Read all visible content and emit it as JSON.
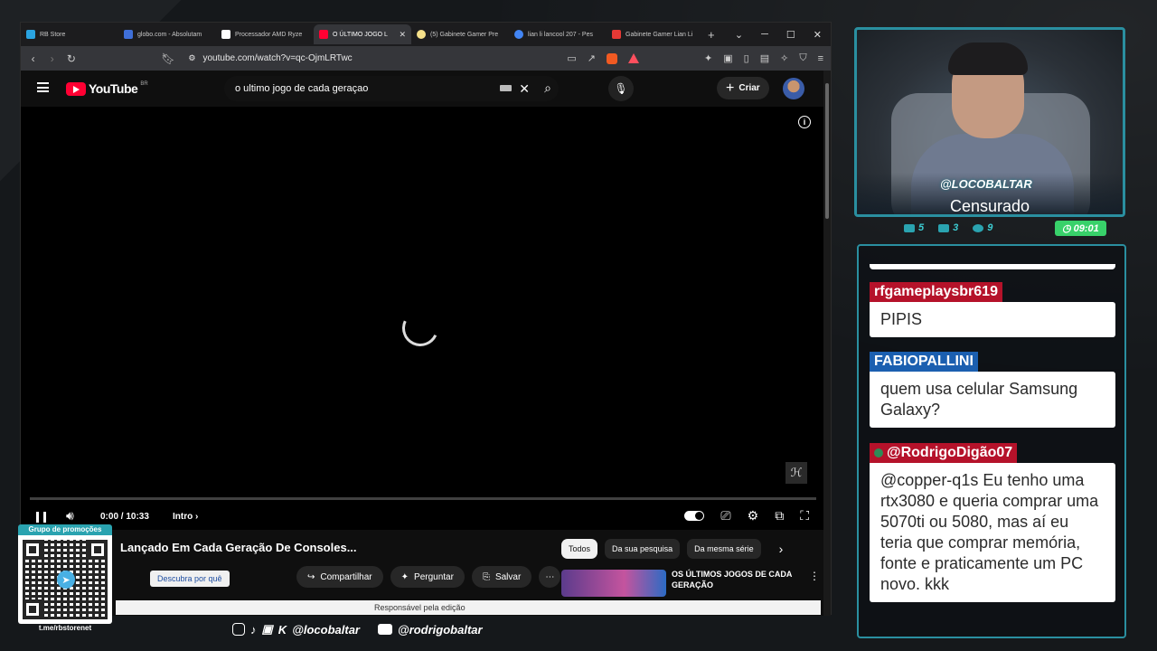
{
  "browser": {
    "tabs": [
      {
        "label": "RB Store",
        "color": "#2aa3e0"
      },
      {
        "label": "globo.com - Absolutam",
        "color": "#3f6fd8"
      },
      {
        "label": "Processador AMD Ryze",
        "color": "#ffffff"
      },
      {
        "label": "O ÚLTIMO JOGO L",
        "color": "#ff0033",
        "active": true
      },
      {
        "label": "(5) Gabinete Gamer Pre",
        "color": "#f5e08a"
      },
      {
        "label": "lian li lancool 207 - Pes",
        "color": "#4285f4"
      },
      {
        "label": "Gabinete Gamer Lian Li",
        "color": "#e53935"
      }
    ],
    "url": "youtube.com/watch?v=qc-OjmLRTwc"
  },
  "youtube": {
    "logo_text": "YouTube",
    "country": "BR",
    "search_value": "o ultimo jogo de cada geraçao",
    "create_label": "Criar",
    "player": {
      "time": "0:00 / 10:33",
      "chapter": "Intro",
      "progress": 0
    },
    "video_title": "Lançado Em Cada Geração De Consoles...",
    "actions": [
      "Compartilhar",
      "Perguntar",
      "Salvar"
    ],
    "chips": [
      "Todos",
      "Da sua pesquisa",
      "Da mesma série"
    ],
    "rec_title": "OS ÚLTIMOS JOGOS DE CADA GERAÇÃO",
    "tooltip": "Descubra por quê",
    "status": "Responsável pela edição"
  },
  "stream": {
    "handle": "@LOCOBALTAR",
    "status": "Censurado",
    "stats": [
      "5",
      "3",
      "9"
    ],
    "timer": "09:01",
    "accent": "#2a8fa0"
  },
  "chat": {
    "messages": [
      {
        "user": "rfgameplaysbr619",
        "text": "PIPIS",
        "color": "red"
      },
      {
        "user": "FABIOPALLINI",
        "text": "quem usa celular Samsung Galaxy?",
        "color": "blue"
      },
      {
        "user": "@RodrigoDigão07",
        "text": "@copper-q1s Eu tenho uma rtx3080 e queria comprar uma 5070ti ou 5080, mas aí eu teria que comprar memória, fonte e praticamente um PC novo. kkk",
        "color": "red"
      }
    ]
  },
  "promo": {
    "label": "Grupo de promoções",
    "url": "t.me/rbstorenet"
  },
  "socials": {
    "handle1": "@locobaltar",
    "handle2": "@rodrigobaltar"
  }
}
